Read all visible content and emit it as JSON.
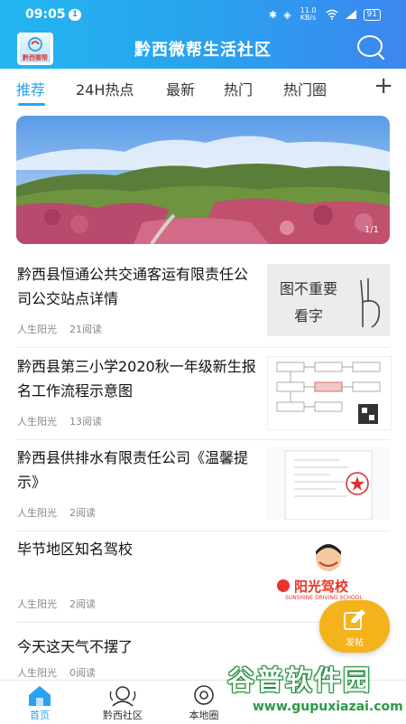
{
  "status": {
    "time": "09:05",
    "badge": "1",
    "signal": "11.0 KB/s",
    "battery": "91"
  },
  "header": {
    "logo_text": "黔西微帮",
    "title": "黔西微帮生活社区"
  },
  "tabs": [
    {
      "label": "推荐",
      "active": true
    },
    {
      "label": "24H热点",
      "active": false
    },
    {
      "label": "最新",
      "active": false
    },
    {
      "label": "热门",
      "active": false
    },
    {
      "label": "热门圈",
      "active": false
    }
  ],
  "banner": {
    "page_indicator": "1/1"
  },
  "news": [
    {
      "title": "黔西县恒通公共交通客运有限责任公司公交站点详情",
      "author": "人生阳光",
      "reads": "21阅读",
      "thumb_text_1": "图不重要",
      "thumb_text_2": "看字"
    },
    {
      "title": "黔西县第三小学2020秋一年级新生报名工作流程示意图",
      "author": "人生阳光",
      "reads": "13阅读"
    },
    {
      "title": "黔西县供排水有限责任公司《温馨提示》",
      "author": "人生阳光",
      "reads": "2阅读"
    },
    {
      "title": "毕节地区知名驾校",
      "author": "人生阳光",
      "reads": "2阅读",
      "thumb_text_1": "阳光驾校",
      "thumb_text_2": "SUNSHINE DRIVING SCHOOL"
    },
    {
      "title": "今天这天气不摆了",
      "author": "人生阳光",
      "reads": "0阅读"
    }
  ],
  "fab": {
    "label": "发帖"
  },
  "bottom_nav": [
    {
      "label": "首页",
      "active": true
    },
    {
      "label": "黔西社区",
      "active": false
    },
    {
      "label": "本地圈",
      "active": false
    }
  ],
  "watermark": {
    "title": "谷普软件园",
    "url": "www.gupuxiazai.com"
  },
  "colors": {
    "accent": "#27a3ef",
    "fab": "#f4b21b",
    "header_start": "#23b6f0",
    "header_end": "#3d86f0"
  }
}
